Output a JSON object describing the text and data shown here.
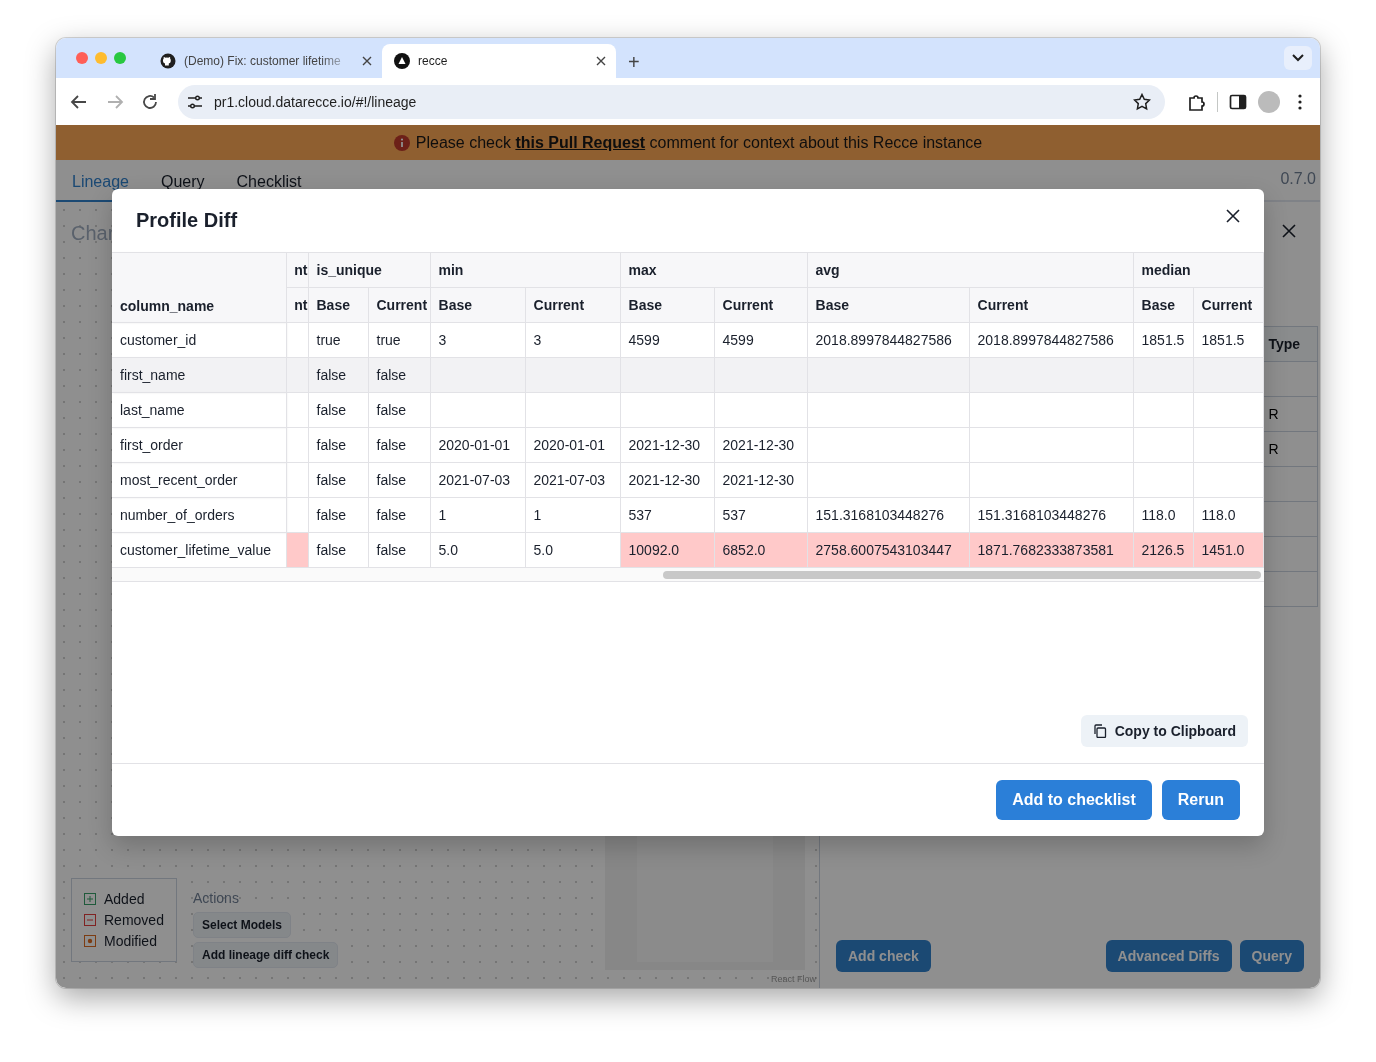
{
  "browser": {
    "tabs": [
      {
        "title": "(Demo) Fix: customer lifetime",
        "selected": false
      },
      {
        "title": "recce",
        "selected": true
      }
    ],
    "new_tab": "+",
    "url": "pr1.cloud.datarecce.io/#!/lineage"
  },
  "banner": {
    "before": "Please check ",
    "link": "this Pull Request",
    "after": " comment for context about this Recce instance"
  },
  "app": {
    "tabs": [
      {
        "label": "Lineage",
        "selected": true
      },
      {
        "label": "Query",
        "selected": false
      },
      {
        "label": "Checklist",
        "selected": false
      }
    ],
    "version": "0.7.0",
    "canvas": {
      "heading": "Char",
      "legend": [
        {
          "label": "Added",
          "kind": "added"
        },
        {
          "label": "Removed",
          "kind": "removed"
        },
        {
          "label": "Modified",
          "kind": "modified"
        }
      ],
      "actions": {
        "title": "Actions",
        "buttons": [
          "Select Models",
          "Add lineage diff check"
        ]
      },
      "attribution": "React Flow"
    },
    "panel": {
      "table": {
        "header": "Type",
        "rows": [
          null,
          "R",
          "R",
          null,
          null,
          null,
          null
        ]
      },
      "left_buttons": [
        "Add check"
      ],
      "right_buttons": [
        "Advanced Diffs",
        "Query"
      ]
    }
  },
  "modal": {
    "title": "Profile Diff",
    "key_column": "column_name",
    "groups": [
      {
        "label": "nt",
        "columns": [
          "nt"
        ]
      },
      {
        "label": "is_unique",
        "columns": [
          "Base",
          "Current"
        ]
      },
      {
        "label": "min",
        "columns": [
          "Base",
          "Current"
        ]
      },
      {
        "label": "max",
        "columns": [
          "Base",
          "Current"
        ]
      },
      {
        "label": "avg",
        "columns": [
          "Base",
          "Current"
        ]
      },
      {
        "label": "median",
        "columns": [
          "Base",
          "Current"
        ]
      }
    ],
    "rows": [
      {
        "name": "customer_id",
        "hovered": false,
        "cells": [
          {
            "changed": false
          },
          {
            "text": "true",
            "changed": false
          },
          {
            "text": "true",
            "changed": false
          },
          {
            "text": "3",
            "changed": false
          },
          {
            "text": "3",
            "changed": false
          },
          {
            "text": "4599",
            "changed": false
          },
          {
            "text": "4599",
            "changed": false
          },
          {
            "text": "2018.8997844827586",
            "changed": false
          },
          {
            "text": "2018.8997844827586",
            "changed": false
          },
          {
            "text": "1851.5",
            "changed": false
          },
          {
            "text": "1851.5",
            "changed": false
          }
        ]
      },
      {
        "name": "first_name",
        "hovered": true,
        "cells": [
          {
            "changed": false
          },
          {
            "text": "false",
            "changed": false
          },
          {
            "text": "false",
            "changed": false
          },
          {
            "changed": false
          },
          {
            "changed": false
          },
          {
            "changed": false
          },
          {
            "changed": false
          },
          {
            "changed": false
          },
          {
            "changed": false
          },
          {
            "changed": false
          },
          {
            "changed": false
          }
        ]
      },
      {
        "name": "last_name",
        "hovered": false,
        "cells": [
          {
            "changed": false
          },
          {
            "text": "false",
            "changed": false
          },
          {
            "text": "false",
            "changed": false
          },
          {
            "changed": false
          },
          {
            "changed": false
          },
          {
            "changed": false
          },
          {
            "changed": false
          },
          {
            "changed": false
          },
          {
            "changed": false
          },
          {
            "changed": false
          },
          {
            "changed": false
          }
        ]
      },
      {
        "name": "first_order",
        "hovered": false,
        "cells": [
          {
            "changed": false
          },
          {
            "text": "false",
            "changed": false
          },
          {
            "text": "false",
            "changed": false
          },
          {
            "text": "2020-01-01",
            "changed": false
          },
          {
            "text": "2020-01-01",
            "changed": false
          },
          {
            "text": "2021-12-30",
            "changed": false
          },
          {
            "text": "2021-12-30",
            "changed": false
          },
          {
            "changed": false
          },
          {
            "changed": false
          },
          {
            "changed": false
          },
          {
            "changed": false
          }
        ]
      },
      {
        "name": "most_recent_order",
        "hovered": false,
        "cells": [
          {
            "changed": false
          },
          {
            "text": "false",
            "changed": false
          },
          {
            "text": "false",
            "changed": false
          },
          {
            "text": "2021-07-03",
            "changed": false
          },
          {
            "text": "2021-07-03",
            "changed": false
          },
          {
            "text": "2021-12-30",
            "changed": false
          },
          {
            "text": "2021-12-30",
            "changed": false
          },
          {
            "changed": false
          },
          {
            "changed": false
          },
          {
            "changed": false
          },
          {
            "changed": false
          }
        ]
      },
      {
        "name": "number_of_orders",
        "hovered": false,
        "cells": [
          {
            "changed": false
          },
          {
            "text": "false",
            "changed": false
          },
          {
            "text": "false",
            "changed": false
          },
          {
            "text": "1",
            "changed": false
          },
          {
            "text": "1",
            "changed": false
          },
          {
            "text": "537",
            "changed": false
          },
          {
            "text": "537",
            "changed": false
          },
          {
            "text": "151.3168103448276",
            "changed": false
          },
          {
            "text": "151.3168103448276",
            "changed": false
          },
          {
            "text": "118.0",
            "changed": false
          },
          {
            "text": "118.0",
            "changed": false
          }
        ]
      },
      {
        "name": "customer_lifetime_value",
        "hovered": false,
        "cells": [
          {
            "changed": true
          },
          {
            "text": "false",
            "changed": false
          },
          {
            "text": "false",
            "changed": false
          },
          {
            "text": "5.0",
            "changed": false
          },
          {
            "text": "5.0",
            "changed": false
          },
          {
            "text": "10092.0",
            "changed": true
          },
          {
            "text": "6852.0",
            "changed": true
          },
          {
            "text": "2758.6007543103447",
            "changed": true
          },
          {
            "text": "1871.7682333873581",
            "changed": true
          },
          {
            "text": "2126.5",
            "changed": true
          },
          {
            "text": "1451.0",
            "changed": true
          }
        ]
      }
    ],
    "copy_button": "Copy to Clipboard",
    "buttons": [
      "Add to checklist",
      "Rerun"
    ]
  }
}
